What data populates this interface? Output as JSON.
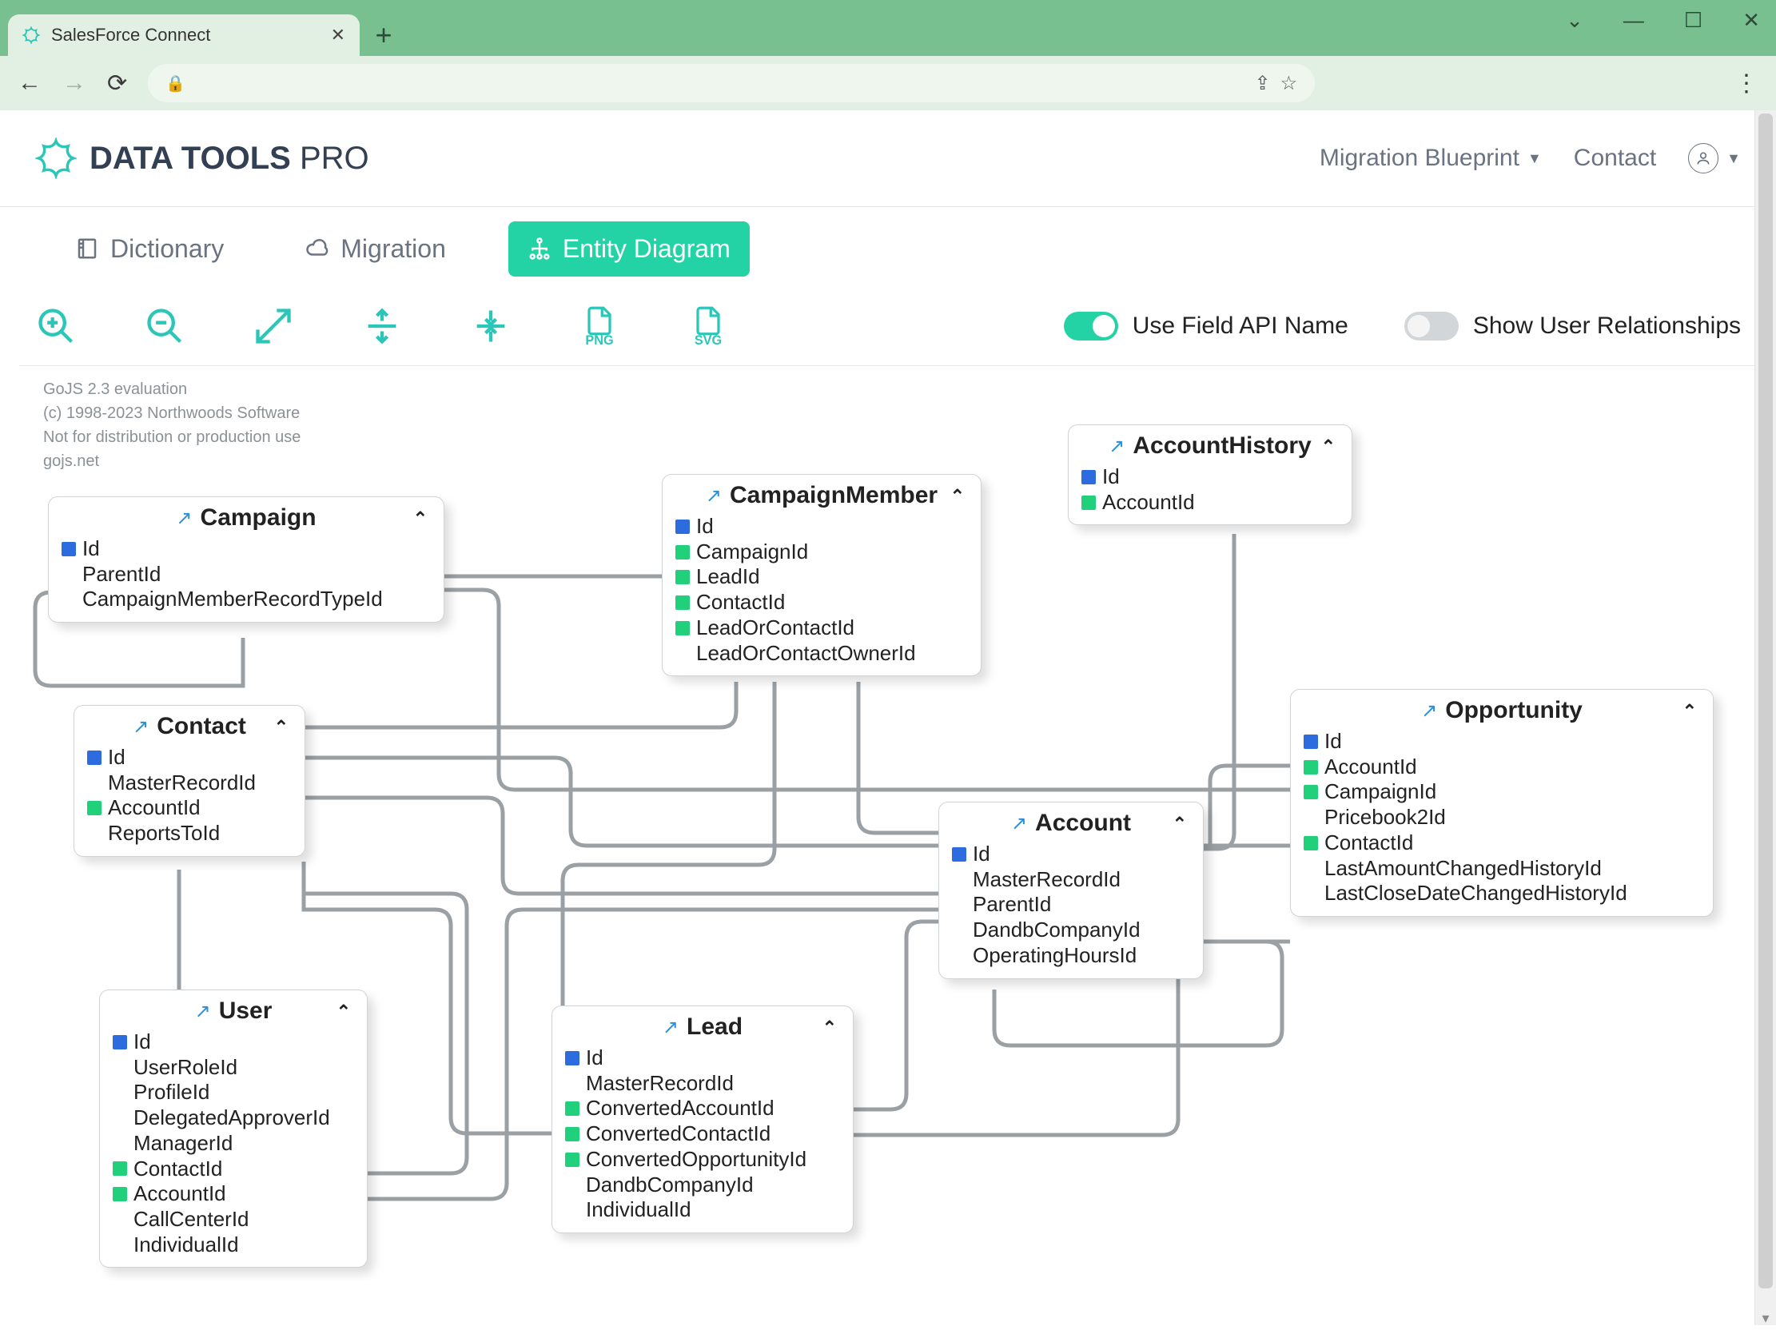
{
  "browser": {
    "tab_title": "SalesForce Connect"
  },
  "app": {
    "logo_main": "DATA TOOLS ",
    "logo_light": "PRO",
    "nav": {
      "migration_blueprint": "Migration Blueprint",
      "contact": "Contact"
    }
  },
  "tabs": {
    "dictionary": "Dictionary",
    "migration": "Migration",
    "entity_diagram": "Entity Diagram"
  },
  "toolbar": {
    "png_label": "PNG",
    "svg_label": "SVG",
    "use_api_name": "Use Field API Name",
    "show_user_rel": "Show User Relationships"
  },
  "gojs": {
    "l1": "GoJS 2.3 evaluation",
    "l2": "(c) 1998-2023 Northwoods Software",
    "l3": "Not for distribution or production use",
    "l4": "gojs.net"
  },
  "entities": [
    {
      "name": "Campaign",
      "fields": [
        {
          "tag": "blue",
          "label": "Id"
        },
        {
          "tag": "none",
          "label": "ParentId"
        },
        {
          "tag": "none",
          "label": "CampaignMemberRecordTypeId"
        }
      ]
    },
    {
      "name": "CampaignMember",
      "fields": [
        {
          "tag": "blue",
          "label": "Id"
        },
        {
          "tag": "green",
          "label": "CampaignId"
        },
        {
          "tag": "green",
          "label": "LeadId"
        },
        {
          "tag": "green",
          "label": "ContactId"
        },
        {
          "tag": "green",
          "label": "LeadOrContactId"
        },
        {
          "tag": "none",
          "label": "LeadOrContactOwnerId"
        }
      ]
    },
    {
      "name": "AccountHistory",
      "fields": [
        {
          "tag": "blue",
          "label": "Id"
        },
        {
          "tag": "green",
          "label": "AccountId"
        }
      ]
    },
    {
      "name": "Contact",
      "fields": [
        {
          "tag": "blue",
          "label": "Id"
        },
        {
          "tag": "none",
          "label": "MasterRecordId"
        },
        {
          "tag": "green",
          "label": "AccountId"
        },
        {
          "tag": "none",
          "label": "ReportsToId"
        }
      ]
    },
    {
      "name": "Account",
      "fields": [
        {
          "tag": "blue",
          "label": "Id"
        },
        {
          "tag": "none",
          "label": "MasterRecordId"
        },
        {
          "tag": "none",
          "label": "ParentId"
        },
        {
          "tag": "none",
          "label": "DandbCompanyId"
        },
        {
          "tag": "none",
          "label": "OperatingHoursId"
        }
      ]
    },
    {
      "name": "Opportunity",
      "fields": [
        {
          "tag": "blue",
          "label": "Id"
        },
        {
          "tag": "green",
          "label": "AccountId"
        },
        {
          "tag": "green",
          "label": "CampaignId"
        },
        {
          "tag": "none",
          "label": "Pricebook2Id"
        },
        {
          "tag": "green",
          "label": "ContactId"
        },
        {
          "tag": "none",
          "label": "LastAmountChangedHistoryId"
        },
        {
          "tag": "none",
          "label": "LastCloseDateChangedHistoryId"
        }
      ]
    },
    {
      "name": "User",
      "fields": [
        {
          "tag": "blue",
          "label": "Id"
        },
        {
          "tag": "none",
          "label": "UserRoleId"
        },
        {
          "tag": "none",
          "label": "ProfileId"
        },
        {
          "tag": "none",
          "label": "DelegatedApproverId"
        },
        {
          "tag": "none",
          "label": "ManagerId"
        },
        {
          "tag": "green",
          "label": "ContactId"
        },
        {
          "tag": "green",
          "label": "AccountId"
        },
        {
          "tag": "none",
          "label": "CallCenterId"
        },
        {
          "tag": "none",
          "label": "IndividualId"
        }
      ]
    },
    {
      "name": "Lead",
      "fields": [
        {
          "tag": "blue",
          "label": "Id"
        },
        {
          "tag": "none",
          "label": "MasterRecordId"
        },
        {
          "tag": "green",
          "label": "ConvertedAccountId"
        },
        {
          "tag": "green",
          "label": "ConvertedContactId"
        },
        {
          "tag": "green",
          "label": "ConvertedOpportunityId"
        },
        {
          "tag": "none",
          "label": "DandbCompanyId"
        },
        {
          "tag": "none",
          "label": "IndividualId"
        }
      ]
    }
  ]
}
